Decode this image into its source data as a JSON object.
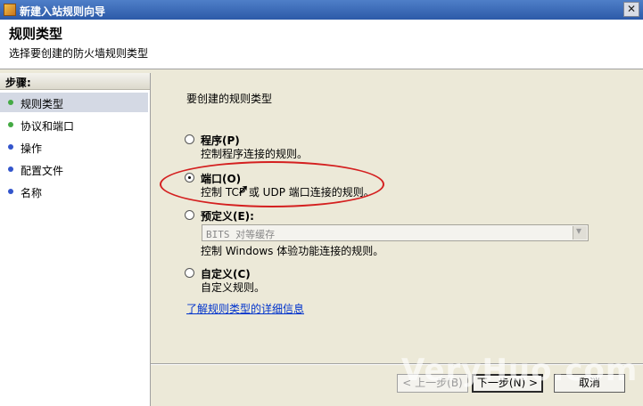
{
  "window": {
    "title": "新建入站规则向导"
  },
  "header": {
    "title": "规则类型",
    "subtitle": "选择要创建的防火墙规则类型"
  },
  "steps": {
    "title": "步骤:",
    "items": [
      {
        "label": "规则类型",
        "color": "#44aa44",
        "active": true
      },
      {
        "label": "协议和端口",
        "color": "#44aa44",
        "active": false
      },
      {
        "label": "操作",
        "color": "#3355cc",
        "active": false
      },
      {
        "label": "配置文件",
        "color": "#3355cc",
        "active": false
      },
      {
        "label": "名称",
        "color": "#3355cc",
        "active": false
      }
    ]
  },
  "content": {
    "question": "要创建的规则类型",
    "options": [
      {
        "label": "程序(P)",
        "description": "控制程序连接的规则。",
        "checked": false
      },
      {
        "label": "端口(O)",
        "description": "控制 TCP 或 UDP 端口连接的规则。",
        "checked": true
      },
      {
        "label": "预定义(E):",
        "description": "控制 Windows 体验功能连接的规则。",
        "checked": false
      },
      {
        "label": "自定义(C)",
        "description": "自定义规则。",
        "checked": false
      }
    ],
    "predefined_select": {
      "value": "BITS 对等缓存"
    },
    "learn_more": "了解规则类型的详细信息"
  },
  "buttons": {
    "back": "< 上一步(B)",
    "next": "下一步(N) >",
    "cancel": "取消"
  },
  "watermark": "VeryHuo.com"
}
